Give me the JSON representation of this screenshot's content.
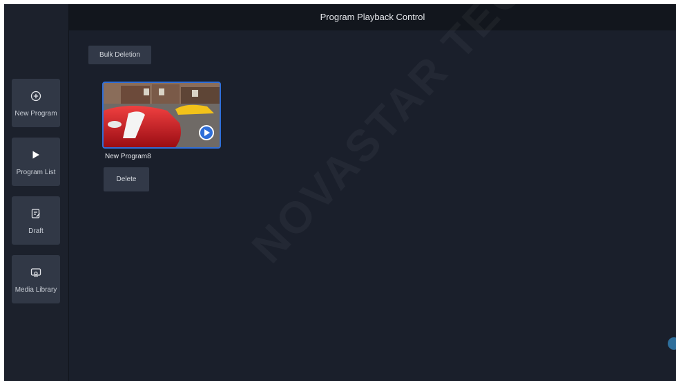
{
  "header": {
    "title": "Program Playback Control"
  },
  "sidebar": {
    "items": [
      {
        "label": "New Program",
        "icon": "plus-circle-icon"
      },
      {
        "label": "Program List",
        "icon": "play-icon"
      },
      {
        "label": "Draft",
        "icon": "edit-icon"
      },
      {
        "label": "Media Library",
        "icon": "media-library-icon"
      }
    ]
  },
  "toolbar": {
    "bulk_delete_label": "Bulk Deletion"
  },
  "programs": [
    {
      "name": "New Program8",
      "delete_label": "Delete"
    }
  ],
  "colors": {
    "background": "#1a1f2b",
    "accent": "#2f6ed8",
    "card": "#313846"
  }
}
